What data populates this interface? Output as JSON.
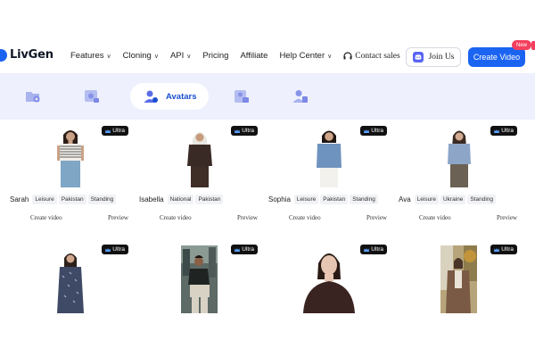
{
  "brand": {
    "name": "LivGen",
    "accent": "#1b64f2"
  },
  "nav": {
    "items": [
      {
        "label": "Features",
        "has_dropdown": true
      },
      {
        "label": "Cloning",
        "has_dropdown": true
      },
      {
        "label": "API",
        "has_dropdown": true
      },
      {
        "label": "Pricing",
        "has_dropdown": false
      },
      {
        "label": "Affiliate",
        "has_dropdown": false
      },
      {
        "label": "Help Center",
        "has_dropdown": true
      }
    ],
    "contact_label": "Contact sales",
    "join_label": "Join Us",
    "create_label": "Create Video",
    "new_badge": "New"
  },
  "categories": {
    "active_label": "Avatars",
    "icons": [
      "folder-add-icon",
      "video-edit-icon",
      "avatar-icon",
      "image-edit-icon",
      "person-doc-icon"
    ]
  },
  "badge_label": "Ultra",
  "cards": [
    {
      "name": "Sarah",
      "tags": [
        "Leisure",
        "Pakistan",
        "Standing"
      ],
      "create_label": "Create video",
      "preview_label": "Preview"
    },
    {
      "name": "Isabella",
      "tags": [
        "National",
        "Pakistan"
      ],
      "create_label": "Create video",
      "preview_label": "Preview"
    },
    {
      "name": "Sophia",
      "tags": [
        "Leisure",
        "Pakistan",
        "Standing"
      ],
      "create_label": "Create video",
      "preview_label": "Preview"
    },
    {
      "name": "Ava",
      "tags": [
        "Leisure",
        "Ukraine",
        "Standing"
      ],
      "create_label": "Create video",
      "preview_label": "Preview"
    },
    {
      "name": "",
      "tags": [],
      "create_label": "",
      "preview_label": ""
    },
    {
      "name": "",
      "tags": [],
      "create_label": "",
      "preview_label": ""
    },
    {
      "name": "",
      "tags": [],
      "create_label": "",
      "preview_label": ""
    },
    {
      "name": "",
      "tags": [],
      "create_label": "",
      "preview_label": ""
    }
  ]
}
